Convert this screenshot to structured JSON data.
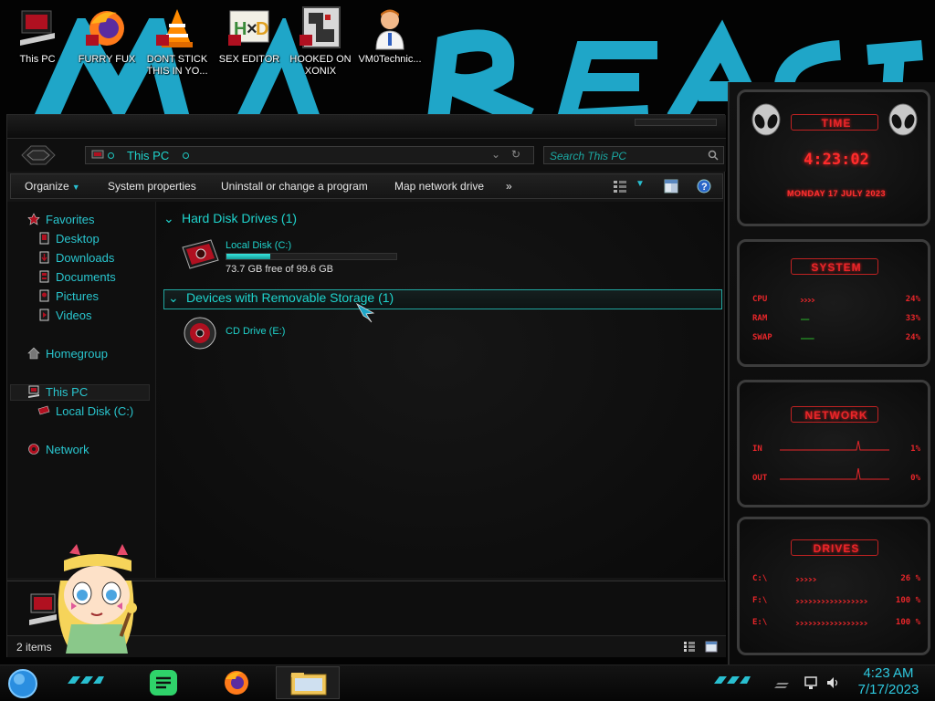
{
  "desktop": {
    "icons": [
      {
        "label": "This PC",
        "icon": "this-pc-icon"
      },
      {
        "label": "FURRY FUX",
        "icon": "firefox-icon"
      },
      {
        "label": "DONT STICK THIS IN YO...",
        "icon": "vlc-icon"
      },
      {
        "label": "SEX EDITOR",
        "icon": "hxd-editor-icon"
      },
      {
        "label": "HOOKED ON XONIX",
        "icon": "xonix-game-icon"
      },
      {
        "label": "VM0Technic...",
        "icon": "doctor-avatar-icon"
      }
    ]
  },
  "explorer": {
    "address": "This PC",
    "search_placeholder": "Search This PC",
    "commands": {
      "organize": "Organize",
      "system_properties": "System properties",
      "uninstall": "Uninstall or change a program",
      "map_drive": "Map network drive",
      "more": "»"
    },
    "nav": {
      "favorites": "Favorites",
      "desktop": "Desktop",
      "downloads": "Downloads",
      "documents": "Documents",
      "pictures": "Pictures",
      "videos": "Videos",
      "homegroup": "Homegroup",
      "this_pc": "This PC",
      "local_disk": "Local Disk (C:)",
      "network": "Network"
    },
    "groups": {
      "hdd": "Hard Disk Drives (1)",
      "removable": "Devices with Removable Storage (1)"
    },
    "drives": {
      "c_name": "Local Disk (C:)",
      "c_free": "73.7 GB free of 99.6 GB",
      "c_used_fraction": 0.26,
      "e_name": "CD Drive (E:)"
    },
    "status": "2 items"
  },
  "gadgets": {
    "time": {
      "title": "TIME",
      "clock": "4:23:02",
      "date": "MONDAY 17 JULY 2023"
    },
    "system": {
      "title": "SYSTEM",
      "rows": [
        {
          "label": "CPU",
          "value": "24%"
        },
        {
          "label": "RAM",
          "value": "33%"
        },
        {
          "label": "SWAP",
          "value": "24%"
        }
      ]
    },
    "network": {
      "title": "NETWORK",
      "rows": [
        {
          "label": "IN",
          "value": "1%"
        },
        {
          "label": "OUT",
          "value": "0%"
        }
      ]
    },
    "drives": {
      "title": "DRIVES",
      "rows": [
        {
          "label": "C:\\",
          "value": "26 %"
        },
        {
          "label": "F:\\",
          "value": "100 %"
        },
        {
          "label": "E:\\",
          "value": "100 %"
        }
      ]
    }
  },
  "taskbar": {
    "time": "4:23 AM",
    "date": "7/17/2023"
  },
  "colors": {
    "accent_cyan": "#1fd3cc",
    "gadget_red": "#e8262a",
    "panel_dark": "#151515"
  }
}
